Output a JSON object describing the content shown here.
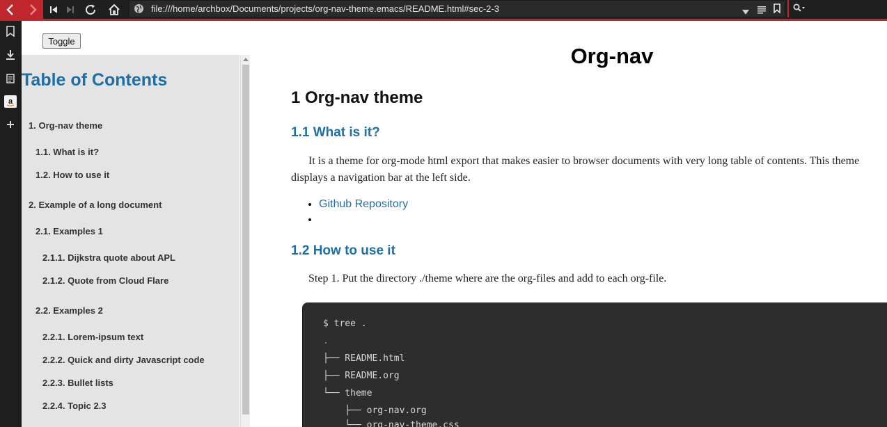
{
  "browser": {
    "url": "file:///home/archbox/Documents/projects/org-nav-theme.emacs/README.html#sec-2-3",
    "icons": [
      "back-icon",
      "forward-icon",
      "first-page-icon",
      "last-page-icon",
      "reload-icon",
      "home-icon",
      "globe-icon",
      "dropdown-icon",
      "reader-icon",
      "bookmark-icon",
      "search-icon"
    ],
    "accent_color": "#c0272d"
  },
  "sidebar_strip": {
    "icons": [
      "bookmark-icon",
      "download-icon",
      "notes-icon",
      "amazon-icon",
      "add-icon"
    ]
  },
  "page": {
    "toggle_label": "Toggle",
    "toc": {
      "title": "Table of Contents",
      "items": [
        {
          "label": "1. Org-nav theme",
          "level": 1
        },
        {
          "label": "1.1. What is it?",
          "level": 2
        },
        {
          "label": "1.2. How to use it",
          "level": 2
        },
        {
          "label": "2. Example of a long document",
          "level": 1
        },
        {
          "label": "2.1. Examples 1",
          "level": 2
        },
        {
          "label": "2.1.1. Dijkstra quote about APL",
          "level": 3
        },
        {
          "label": "2.1.2. Quote from Cloud Flare",
          "level": 3
        },
        {
          "label": "2.2. Examples 2",
          "level": 2
        },
        {
          "label": "2.2.1. Lorem-ipsum text",
          "level": 3
        },
        {
          "label": "2.2.2. Quick and dirty Javascript code",
          "level": 3
        },
        {
          "label": "2.2.3. Bullet lists",
          "level": 3
        },
        {
          "label": "2.2.4. Topic 2.3",
          "level": 3
        }
      ]
    },
    "doc": {
      "title": "Org-nav",
      "h1": "1 Org-nav theme",
      "h2_what": "1.1 What is it?",
      "para1": "It is a theme for org-mode html export that makes easier to browser documents with very long table of contents. This theme displays a navigation bar at the left side.",
      "link_github": "Github Repository",
      "h2_how": "1.2 How to use it",
      "step1": "Step 1. Put the directory ./theme where are the org-files and add to each org-file.",
      "code_lines": [
        "$ tree .",
        ".",
        "├── README.html",
        "├── README.org",
        "└── theme",
        "    ├── org-nav.org",
        "    └── org-nav-theme.css"
      ]
    },
    "link_color": "#1d6fa8"
  }
}
